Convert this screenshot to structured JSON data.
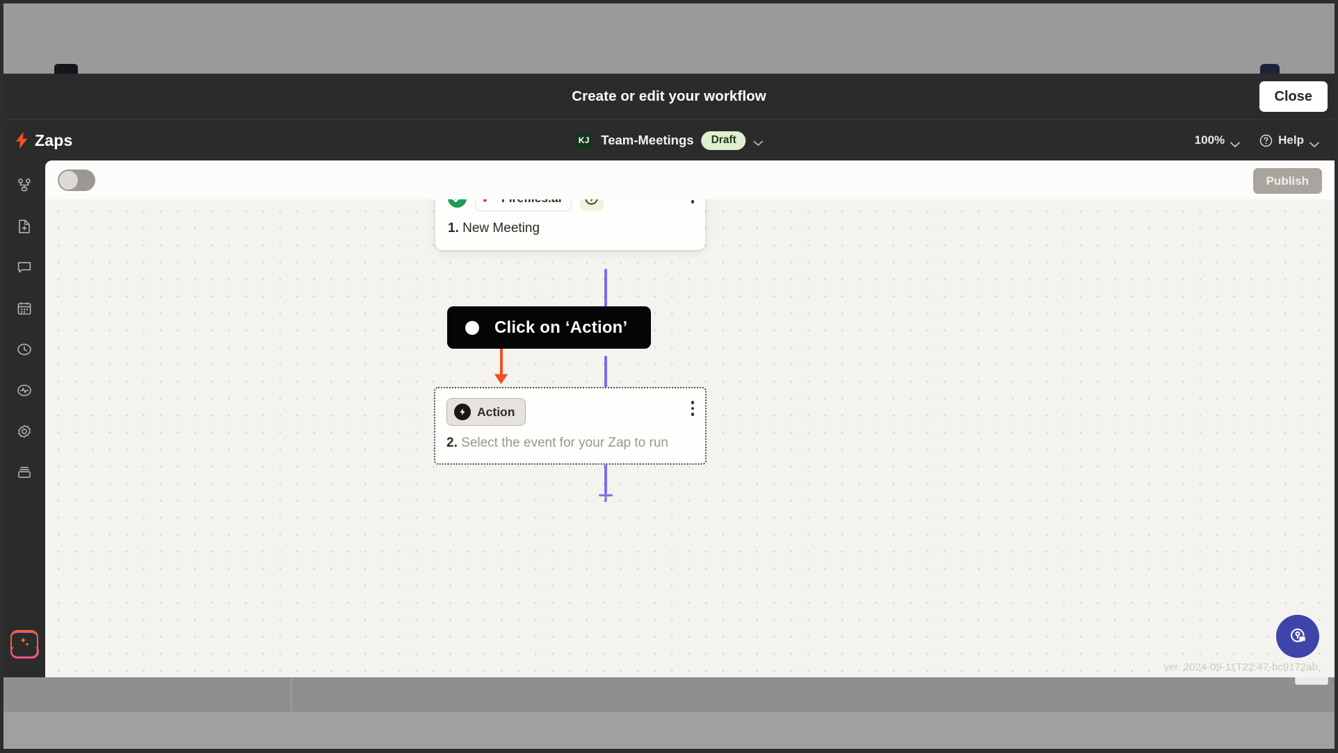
{
  "modal": {
    "title": "Create or edit your workflow",
    "close_label": "Close"
  },
  "header": {
    "brand": "Zaps",
    "brand_icon": "lightning-bolt-icon",
    "avatar_initials": "KJ",
    "zap_name": "Team-Meetings",
    "status_badge": "Draft",
    "zoom_level": "100%",
    "help_label": "Help",
    "help_icon": "question-circle-icon",
    "chevron_icon": "chevron-down-icon"
  },
  "sidebar": {
    "items": [
      {
        "name": "zaps-icon",
        "label": "Zaps"
      },
      {
        "name": "new-doc-icon",
        "label": "Create"
      },
      {
        "name": "chat-icon",
        "label": "Chatbots"
      },
      {
        "name": "tables-icon",
        "label": "Tables"
      },
      {
        "name": "history-icon",
        "label": "Zap History"
      },
      {
        "name": "activity-icon",
        "label": "Activity"
      },
      {
        "name": "settings-gear-icon",
        "label": "Settings"
      },
      {
        "name": "storage-icon",
        "label": "Storage"
      }
    ],
    "ai_button": {
      "name": "ai-sparkle-icon",
      "label": "AI"
    }
  },
  "toolbar": {
    "run_toggle_state": "off",
    "publish_label": "Publish",
    "publish_disabled": true
  },
  "canvas": {
    "version": "ver. 2024-09-11T22:47-bc9172ab",
    "plus_label": "+",
    "support_icon": "support-chat-icon",
    "nodes": [
      {
        "step": "1.",
        "status": "complete",
        "status_icon": "check-circle-icon",
        "app": "Fireflies.ai",
        "app_icon": "fireflies-logo-icon",
        "event_icon": "trigger-bolt-icon",
        "title": "New Meeting",
        "menu_icon": "kebab-menu-icon",
        "placeholder": false
      },
      {
        "step": "2.",
        "status": "empty",
        "action_label": "Action",
        "action_icon": "action-bolt-icon",
        "title": "Select the event for your Zap to run",
        "menu_icon": "kebab-menu-icon",
        "placeholder": true
      }
    ]
  },
  "coach_tip": {
    "message": "Click on ‘Action’",
    "dot_icon": "cursor-dot-icon"
  },
  "colors": {
    "accent_orange": "#f4501d",
    "connector_purple": "#7b6df0",
    "success_green": "#1f9d55",
    "draft_badge_bg": "#dff0d2",
    "fab_indigo": "#3f45a8",
    "canvas_bg": "#f4f3f0",
    "chrome_dark": "#2b2b2b"
  }
}
